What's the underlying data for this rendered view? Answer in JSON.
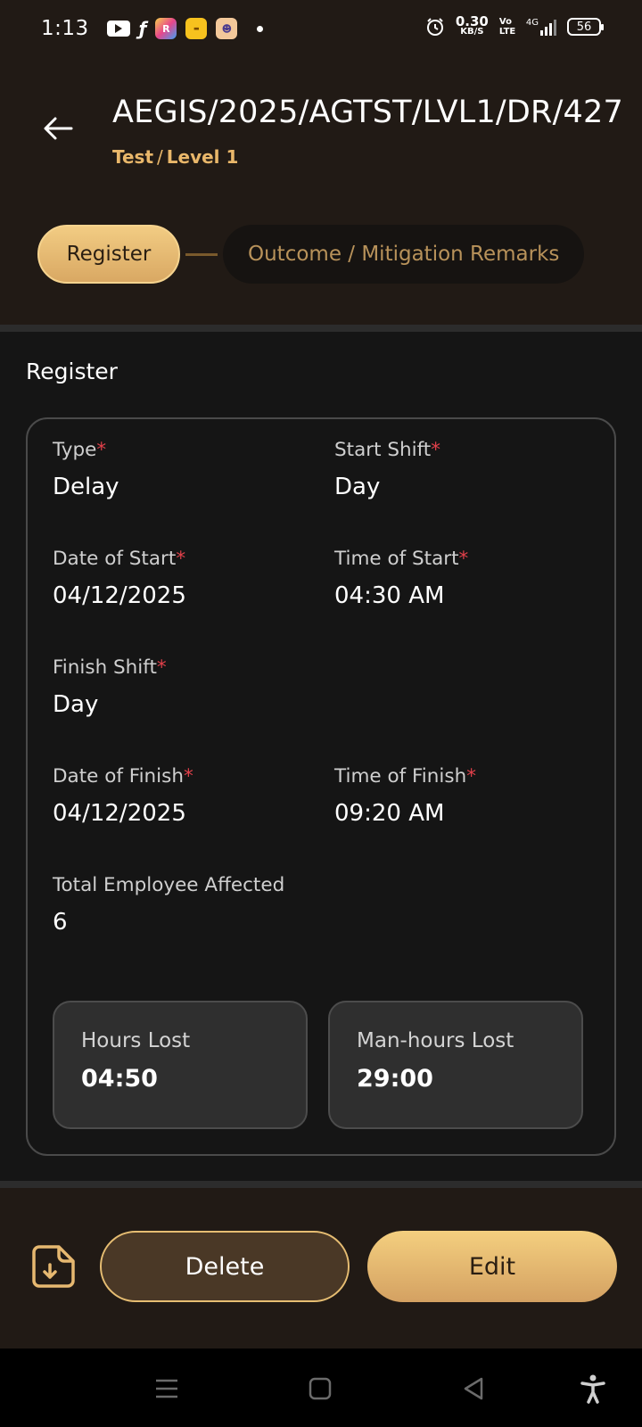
{
  "status_bar": {
    "time": "1:13",
    "net_speed_value": "0.30",
    "net_speed_unit": "KB/S",
    "volte": "Vo LTE",
    "signal": "4G",
    "battery": "56",
    "icons": [
      "youtube-icon",
      "flipkart-icon",
      "app-r-icon",
      "app-yellow-icon",
      "app-avatar-icon",
      "notification-dot",
      "alarm-icon",
      "signal-icon",
      "battery-icon"
    ]
  },
  "header": {
    "title": "AEGIS/2025/AGTST/LVL1/DR/427",
    "breadcrumb_part1": "Test",
    "breadcrumb_separator": "/",
    "breadcrumb_part2": "Level 1"
  },
  "stepper": {
    "steps": [
      {
        "label": "Register",
        "active": true
      },
      {
        "label": "Outcome / Mitigation Remarks",
        "active": false
      }
    ]
  },
  "register": {
    "section_title": "Register",
    "fields": {
      "type": {
        "label": "Type",
        "value": "Delay",
        "required": "*"
      },
      "start_shift": {
        "label": "Start Shift",
        "value": "Day",
        "required": "*"
      },
      "date_of_start": {
        "label": "Date of Start",
        "value": "04/12/2025",
        "required": "*"
      },
      "time_of_start": {
        "label": "Time of Start",
        "value": "04:30 AM",
        "required": "*"
      },
      "finish_shift": {
        "label": "Finish Shift",
        "value": "Day",
        "required": "*"
      },
      "date_of_finish": {
        "label": "Date of Finish",
        "value": "04/12/2025",
        "required": "*"
      },
      "time_of_finish": {
        "label": "Time of Finish",
        "value": "09:20 AM",
        "required": "*"
      },
      "total_employee_affected": {
        "label": "Total Employee Affected",
        "value": "6"
      }
    },
    "stats": {
      "hours_lost": {
        "label": "Hours Lost",
        "value": "04:50"
      },
      "man_hours_lost": {
        "label": "Man-hours Lost",
        "value": "29:00"
      }
    }
  },
  "actions": {
    "download_icon": "file-download-icon",
    "delete_label": "Delete",
    "edit_label": "Edit"
  },
  "colors": {
    "accent": "#e9b76a",
    "header_bg": "#211a15",
    "page_bg": "#151515",
    "required": "#e0404a"
  }
}
